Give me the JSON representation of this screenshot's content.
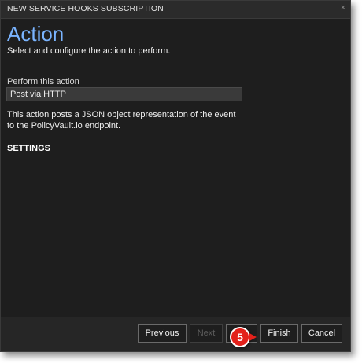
{
  "dialog": {
    "title": "NEW SERVICE HOOKS SUBSCRIPTION",
    "close_icon": "×"
  },
  "page": {
    "heading": "Action",
    "subtitle": "Select and configure the action to perform."
  },
  "action": {
    "label": "Perform this action",
    "selected": "Post via HTTP",
    "description": "This action posts a JSON object representation of the event to the PolicyVault.io endpoint."
  },
  "settings": {
    "heading": "SETTINGS"
  },
  "footer": {
    "previous_label": "Previous",
    "next_label": "Next",
    "finish_label": "Finish",
    "cancel_label": "Cancel"
  },
  "annotation": {
    "step": "5",
    "color": "#e3211b"
  },
  "colors": {
    "background": "#1e1e1e",
    "heading": "#7ab4ff",
    "titlebar": "#2b2b2b"
  }
}
